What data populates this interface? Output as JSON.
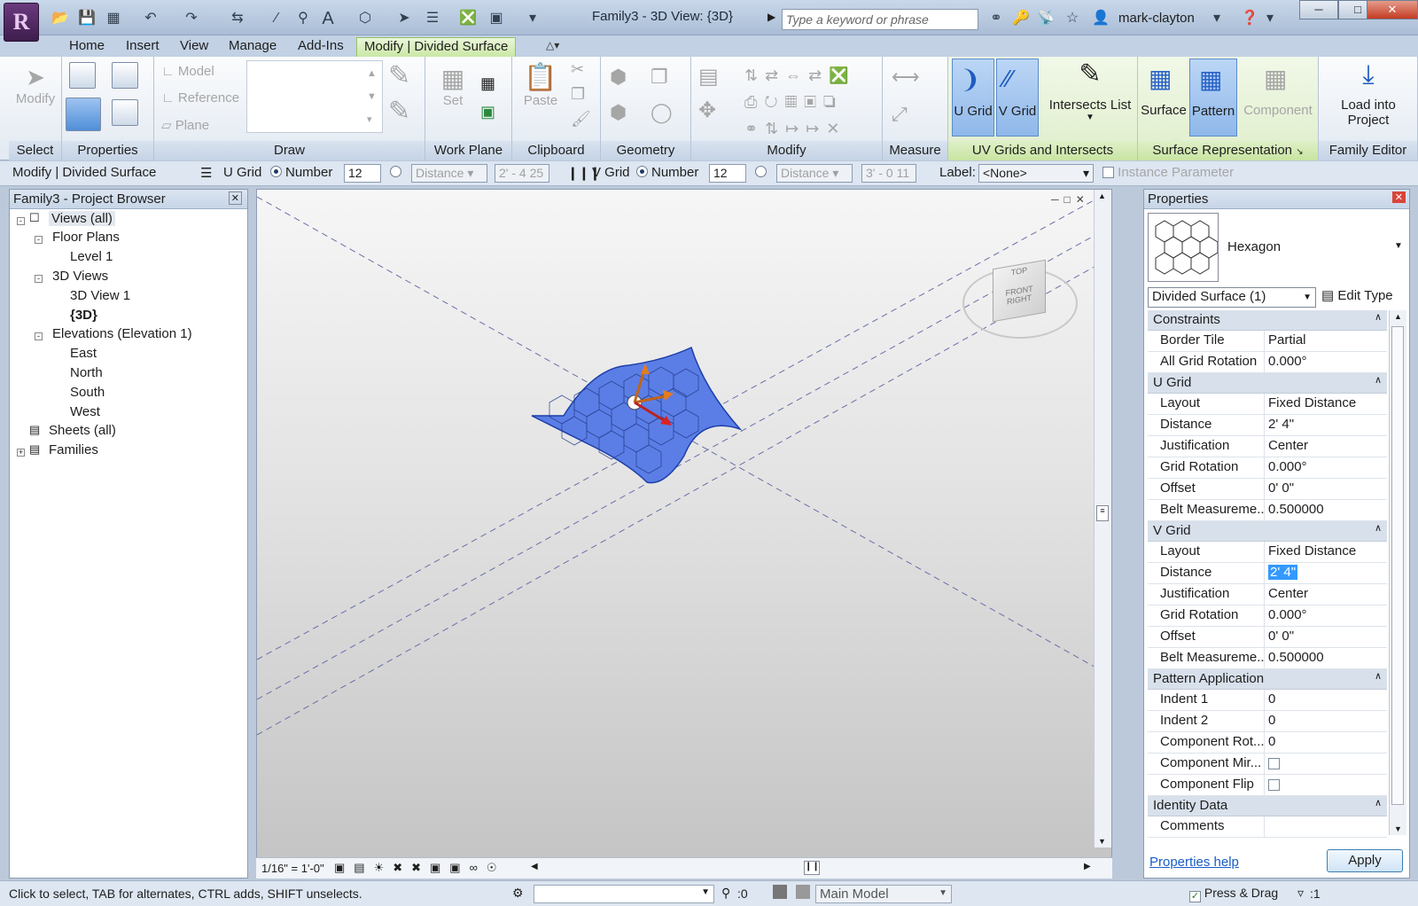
{
  "app": {
    "window_title": "Family3 - 3D View: {3D}",
    "search_placeholder": "Type a keyword or phrase",
    "user": "mark-clayton"
  },
  "tabs": [
    "Home",
    "Insert",
    "View",
    "Manage",
    "Add-Ins",
    "Modify | Divided Surface"
  ],
  "ribbon": {
    "select": {
      "modify": "Modify",
      "label": "Select"
    },
    "properties": {
      "label": "Properties"
    },
    "draw": {
      "model": "Model",
      "reference": "Reference",
      "plane": "Plane",
      "label": "Draw"
    },
    "workplane": {
      "set": "Set",
      "label": "Work Plane"
    },
    "clipboard": {
      "paste": "Paste",
      "label": "Clipboard"
    },
    "geometry": {
      "label": "Geometry"
    },
    "modify": {
      "label": "Modify"
    },
    "measure": {
      "label": "Measure"
    },
    "uvgrids": {
      "ugrid": "U Grid",
      "vgrid": "V Grid",
      "intersects": "Intersects List",
      "label": "UV Grids and Intersects"
    },
    "surfacerep": {
      "surface": "Surface",
      "pattern": "Pattern",
      "component": "Component",
      "label": "Surface Representation"
    },
    "familyeditor": {
      "load1": "Load into",
      "load2": "Project",
      "label": "Family Editor"
    }
  },
  "optionsbar": {
    "context": "Modify | Divided Surface",
    "ugrid": "U Grid",
    "number": "Number",
    "u_number": "12",
    "distance": "Distance",
    "u_distance": "2' - 4 25",
    "vgrid": "V Grid",
    "v_number": "12",
    "v_distance": "3' - 0 11",
    "label_caption": "Label:",
    "label_value": "<None>",
    "instance": "Instance Parameter"
  },
  "browser": {
    "title": "Family3 - Project Browser",
    "items": [
      "Views (all)",
      "Floor Plans",
      "Level 1",
      "3D Views",
      "3D View 1",
      "{3D}",
      "Elevations (Elevation 1)",
      "East",
      "North",
      "South",
      "West",
      "Sheets (all)",
      "Families"
    ]
  },
  "viewport": {
    "scale": "1/16\" = 1'-0\"",
    "cube_top": "TOP",
    "cube_front": "FRONT",
    "cube_right": "RIGHT"
  },
  "properties": {
    "title": "Properties",
    "type_name": "Hexagon",
    "instance_select": "Divided Surface (1)",
    "edit_type": "Edit Type",
    "groups": {
      "constraints": "Constraints",
      "ugrid": "U Grid",
      "vgrid": "V Grid",
      "pattern": "Pattern Application",
      "identity": "Identity Data"
    },
    "rows": {
      "border_tile": [
        "Border Tile",
        "Partial"
      ],
      "all_rot": [
        "All Grid Rotation",
        "0.000°"
      ],
      "u_layout": [
        "Layout",
        "Fixed Distance"
      ],
      "u_dist": [
        "Distance",
        "2'  4\""
      ],
      "u_just": [
        "Justification",
        "Center"
      ],
      "u_rot": [
        "Grid Rotation",
        "0.000°"
      ],
      "u_off": [
        "Offset",
        "0'  0\""
      ],
      "u_belt": [
        "Belt Measureme...",
        "0.500000"
      ],
      "v_layout": [
        "Layout",
        "Fixed Distance"
      ],
      "v_dist": [
        "Distance",
        "2'  4\""
      ],
      "v_just": [
        "Justification",
        "Center"
      ],
      "v_rot": [
        "Grid Rotation",
        "0.000°"
      ],
      "v_off": [
        "Offset",
        "0'  0\""
      ],
      "v_belt": [
        "Belt Measureme...",
        "0.500000"
      ],
      "indent1": [
        "Indent 1",
        "0"
      ],
      "indent2": [
        "Indent 2",
        "0"
      ],
      "comp_rot": [
        "Component Rot...",
        "0"
      ],
      "comp_mir": [
        "Component Mir...",
        ""
      ],
      "comp_flip": [
        "Component Flip",
        ""
      ],
      "comments": [
        "Comments",
        ""
      ]
    },
    "help": "Properties help",
    "apply": "Apply"
  },
  "statusbar": {
    "hint": "Click to select, TAB for alternates, CTRL adds, SHIFT unselects.",
    "sel_count": ":0",
    "model": "Main Model",
    "press_drag": "Press & Drag",
    "filter": ":1"
  },
  "colors": {
    "accent": "#3399ff",
    "surface": "#5b7ee6",
    "ribbon_context": "#c8e7a2"
  }
}
